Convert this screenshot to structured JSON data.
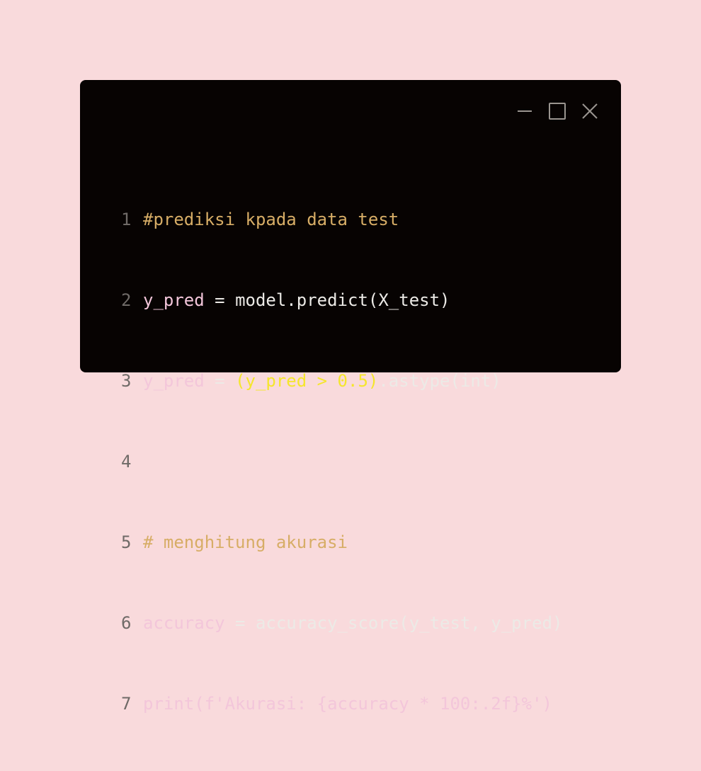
{
  "colors": {
    "page_background": "#f9dadc",
    "window_background": "#070302",
    "line_number": "#6f6a67",
    "comment": "#d7ad66",
    "identifier": "#f3c6da",
    "default_text": "#eceae6",
    "highlight": "#f5e62c"
  },
  "window_controls": {
    "minimize_icon": "minimize-icon",
    "maximize_icon": "maximize-icon",
    "close_icon": "close-icon"
  },
  "code": {
    "lines": [
      {
        "number": "1",
        "comment": "#prediksi kpada data test"
      },
      {
        "number": "2",
        "var": "y_pred",
        "op": " = ",
        "rest": "model.predict(X_test)"
      },
      {
        "number": "3",
        "var": "y_pred",
        "op": " = ",
        "highlight": "(y_pred > 0.5)",
        "rest": ".astype(int)"
      },
      {
        "number": "4",
        "empty": ""
      },
      {
        "number": "5",
        "comment": "# menghitung akurasi"
      },
      {
        "number": "6",
        "var": "accuracy",
        "op": " = ",
        "rest": "accuracy_score(y_test, y_pred)"
      },
      {
        "number": "7",
        "var": "print(f'Akurasi: {accuracy * 100:.2f}%')"
      }
    ]
  }
}
